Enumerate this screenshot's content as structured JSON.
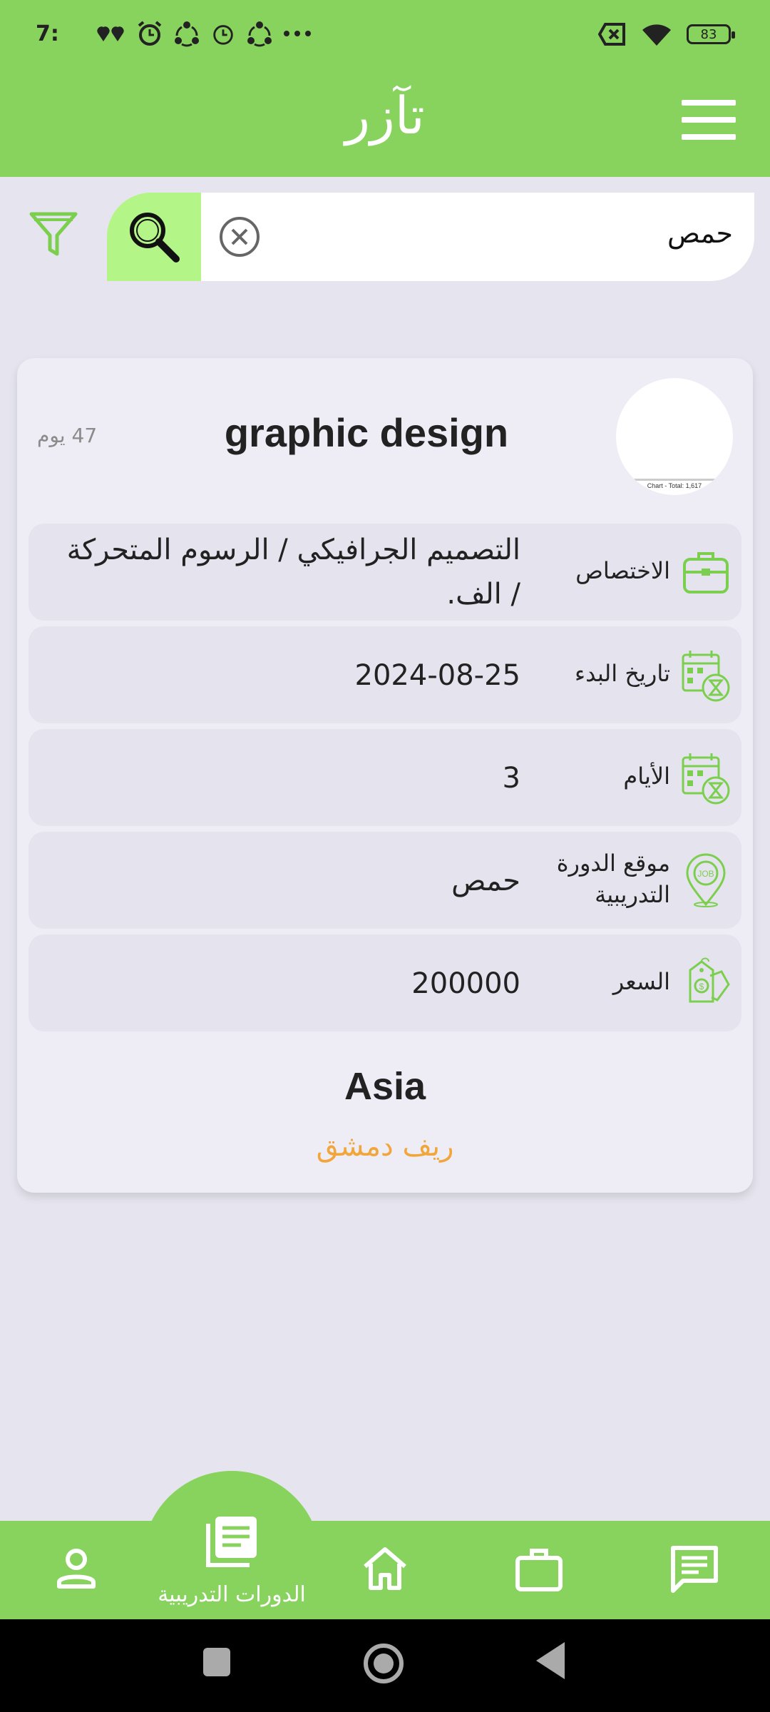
{
  "status_bar": {
    "time": "7:",
    "battery": "83"
  },
  "app_bar": {
    "title": "تآزر"
  },
  "search": {
    "value": "حمص"
  },
  "card": {
    "title": "graphic design",
    "days_ago": "47 يوم",
    "logo_caption": "Chart - Total: 1,617",
    "rows": [
      {
        "label": "الاختصاص",
        "value": "التصميم الجرافيكي / الرسوم المتحركة / الف."
      },
      {
        "label": "تاريخ البدء",
        "value": "2024-08-25"
      },
      {
        "label": "الأيام",
        "value": "3"
      },
      {
        "label": "موقع الدورة التدريبية",
        "value": "حمص"
      },
      {
        "label": "السعر",
        "value": "200000"
      }
    ],
    "region": "Asia",
    "city": "ريف دمشق"
  },
  "bottom_nav": {
    "active_label": "الدورات التدريبية"
  },
  "colors": {
    "primary_green": "#88d25e",
    "light_green": "#b4f587",
    "accent_orange": "#f1a63b"
  }
}
